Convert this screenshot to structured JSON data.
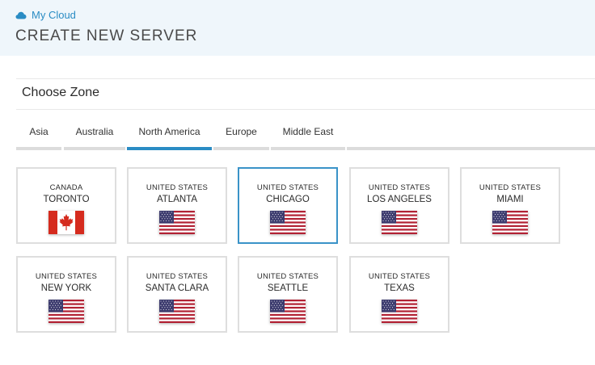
{
  "header": {
    "brand": "My Cloud",
    "title": "CREATE NEW SERVER"
  },
  "section": {
    "title": "Choose Zone"
  },
  "tabs": [
    {
      "label": "Asia"
    },
    {
      "label": "Australia"
    },
    {
      "label": "North America",
      "active": true
    },
    {
      "label": "Europe"
    },
    {
      "label": "Middle East"
    }
  ],
  "zones": [
    {
      "country": "CANADA",
      "city": "TORONTO",
      "flag": "canada-flag"
    },
    {
      "country": "UNITED STATES",
      "city": "ATLANTA",
      "flag": "us-flag"
    },
    {
      "country": "UNITED STATES",
      "city": "CHICAGO",
      "flag": "us-flag",
      "selected": true
    },
    {
      "country": "UNITED STATES",
      "city": "LOS ANGELES",
      "flag": "us-flag"
    },
    {
      "country": "UNITED STATES",
      "city": "MIAMI",
      "flag": "us-flag"
    },
    {
      "country": "UNITED STATES",
      "city": "NEW YORK",
      "flag": "us-flag"
    },
    {
      "country": "UNITED STATES",
      "city": "SANTA CLARA",
      "flag": "us-flag"
    },
    {
      "country": "UNITED STATES",
      "city": "SEATTLE",
      "flag": "us-flag"
    },
    {
      "country": "UNITED STATES",
      "city": "TEXAS",
      "flag": "us-flag"
    }
  ],
  "colors": {
    "accent": "#2a8cc4",
    "header_bg": "#eff6fb",
    "card_border": "#dedede",
    "flag_red": "#d52b1e",
    "us_red": "#b22234",
    "us_blue": "#3c3b6e"
  }
}
